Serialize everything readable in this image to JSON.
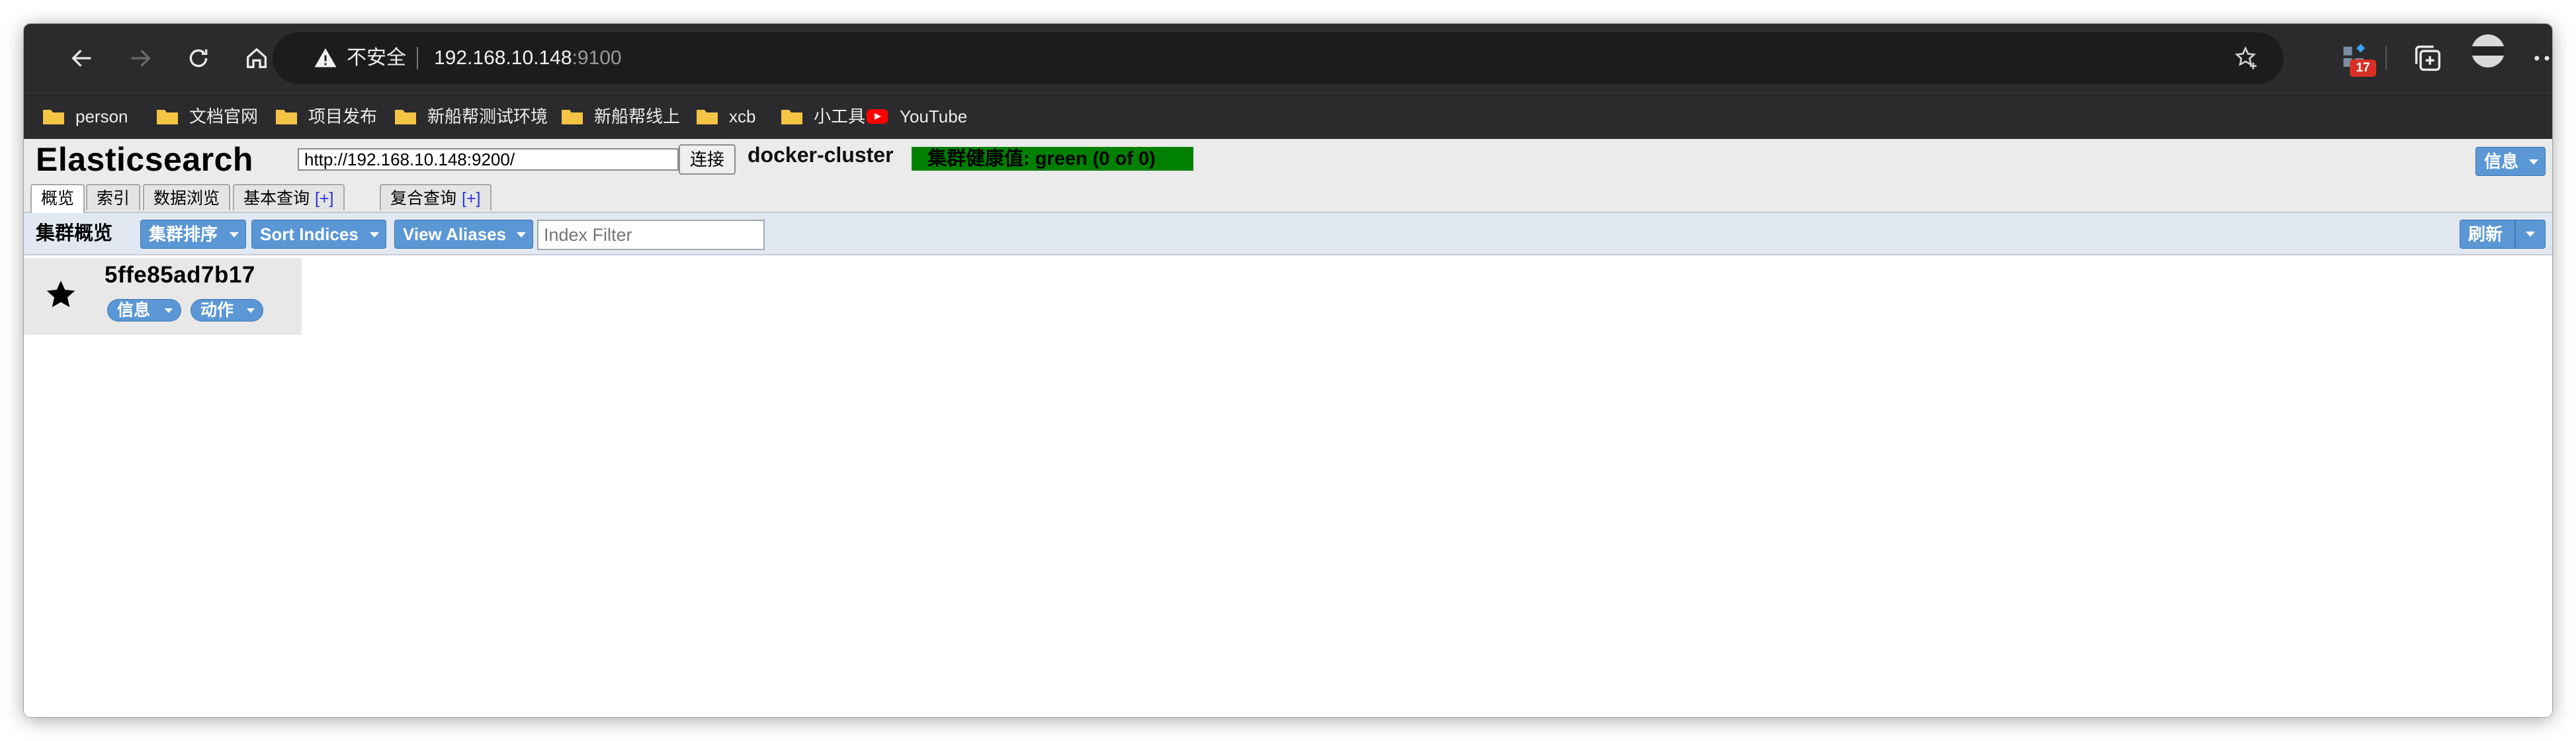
{
  "browser": {
    "security_label": "不安全",
    "url_host": "192.168.10.148",
    "url_port": ":9100",
    "extension_badge": "17",
    "icons": [
      "back-icon",
      "forward-icon",
      "reload-icon",
      "home-icon",
      "warning-icon",
      "favorite-add-icon",
      "extension-icon",
      "collections-icon",
      "avatar",
      "more-icon"
    ]
  },
  "bookmarks": [
    {
      "label": "person",
      "icon": "folder-icon"
    },
    {
      "label": "文档官网",
      "icon": "folder-icon"
    },
    {
      "label": "项目发布",
      "icon": "folder-icon"
    },
    {
      "label": "新船帮测试环境",
      "icon": "folder-icon"
    },
    {
      "label": "新船帮线上",
      "icon": "folder-icon"
    },
    {
      "label": "xcb",
      "icon": "folder-icon"
    },
    {
      "label": "小工具",
      "icon": "folder-icon"
    },
    {
      "label": "YouTube",
      "icon": "youtube-icon"
    }
  ],
  "es": {
    "title": "Elasticsearch",
    "connect_url": "http://192.168.10.148:9200/",
    "connect_button": "连接",
    "cluster_name": "docker-cluster",
    "health_text": "集群健康值: green (0 of 0)",
    "info_button": "信息",
    "tabs": [
      {
        "label": "概览",
        "active": true,
        "plus": ""
      },
      {
        "label": "索引",
        "active": false,
        "plus": ""
      },
      {
        "label": "数据浏览",
        "active": false,
        "plus": ""
      },
      {
        "label": "基本查询",
        "active": false,
        "plus": "[+]"
      },
      {
        "label": "复合查询",
        "active": false,
        "plus": "[+]"
      }
    ],
    "overview": {
      "title": "集群概览",
      "sort_cluster_button": "集群排序",
      "sort_indices_button": "Sort Indices",
      "view_aliases_button": "View Aliases",
      "index_filter_placeholder": "Index Filter",
      "refresh_button": "刷新"
    },
    "node": {
      "name": "5ffe85ad7b17",
      "info_button": "信息",
      "action_button": "动作",
      "master_icon": "star-icon"
    }
  },
  "colors": {
    "chrome_bg": "#2b2b2d",
    "health_green": "#008000",
    "button_blue": "#5b97d4",
    "tab_plus_blue": "#2c31d8"
  }
}
